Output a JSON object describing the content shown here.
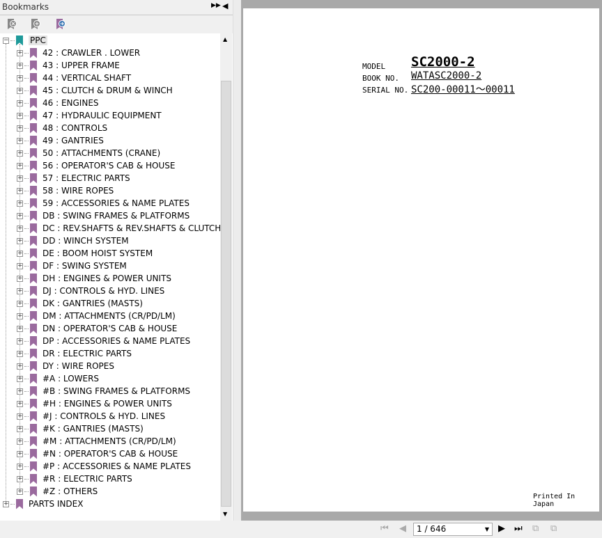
{
  "panel": {
    "title": "Bookmarks",
    "expand_icon": "double-arrow-right-icon",
    "collapse_icon": "arrow-left-icon"
  },
  "tools": [
    "delete-bookmark-icon",
    "add-bookmark-icon",
    "goto-bookmark-icon"
  ],
  "colors": {
    "bookmark": "#9a6a9e",
    "root_bookmark": "#1f9a9a",
    "page_bg": "#a9a9a9"
  },
  "tree": {
    "root": "PPC",
    "items": [
      "42 : CRAWLER . LOWER",
      "43 : UPPER FRAME",
      "44 : VERTICAL SHAFT",
      "45 : CLUTCH & DRUM & WINCH",
      "46 : ENGINES",
      "47 : HYDRAULIC EQUIPMENT",
      "48 : CONTROLS",
      "49 : GANTRIES",
      "50 : ATTACHMENTS (CRANE)",
      "56 : OPERATOR'S CAB & HOUSE",
      "57 : ELECTRIC PARTS",
      "58 : WIRE ROPES",
      "59 : ACCESSORIES & NAME PLATES",
      "DB : SWING FRAMES & PLATFORMS",
      "DC : REV.SHAFTS & REV.SHAFTS & CLUTCH",
      "DD : WINCH SYSTEM",
      "DE : BOOM HOIST SYSTEM",
      "DF : SWING SYSTEM",
      "DH : ENGINES & POWER UNITS",
      "DJ : CONTROLS & HYD. LINES",
      "DK : GANTRIES (MASTS)",
      "DM : ATTACHMENTS (CR/PD/LM)",
      "DN : OPERATOR'S CAB & HOUSE",
      "DP : ACCESSORIES & NAME PLATES",
      "DR : ELECTRIC PARTS",
      "DY : WIRE ROPES",
      "#A : LOWERS",
      "#B : SWING FRAMES & PLATFORMS",
      "#H : ENGINES & POWER UNITS",
      "#J : CONTROLS & HYD. LINES",
      "#K : GANTRIES (MASTS)",
      "#M : ATTACHMENTS (CR/PD/LM)",
      "#N : OPERATOR'S CAB & HOUSE",
      "#P : ACCESSORIES & NAME PLATES",
      "#R : ELECTRIC PARTS",
      "#Z : OTHERS"
    ],
    "sibling": "PARTS INDEX"
  },
  "document": {
    "model_label": "MODEL",
    "model": "SC2000-2",
    "book_label": "BOOK NO.",
    "book": "WATASC2000-2",
    "serial_label": "SERIAL NO.",
    "serial": "SC200-00011～00011",
    "footer": "Printed In Japan"
  },
  "nav": {
    "page": "1 / 646"
  }
}
